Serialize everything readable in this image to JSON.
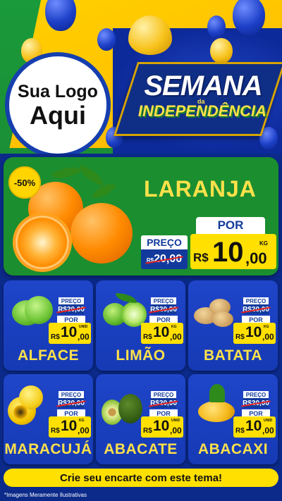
{
  "header": {
    "logo_line1": "Sua Logo",
    "logo_line2": "Aqui",
    "title_main": "SEMANA",
    "title_da": "da",
    "title_sub": "INDEPENDÊNCIA"
  },
  "featured": {
    "discount": "-50%",
    "name": "LARANJA",
    "preco_label": "PREÇO",
    "old_price_currency": "R$",
    "old_price": "20,00",
    "por_label": "POR",
    "currency": "R$",
    "price_int": "10",
    "price_dec": ",00",
    "unit": "KG"
  },
  "products": [
    {
      "name": "ALFACE",
      "preco_label": "PREÇO",
      "old_price": "R$20,00",
      "por_label": "POR",
      "currency": "R$",
      "price_int": "10",
      "price_dec": ",00",
      "unit": "UNID"
    },
    {
      "name": "LIMÃO",
      "preco_label": "PREÇO",
      "old_price": "R$20,00",
      "por_label": "POR",
      "currency": "R$",
      "price_int": "10",
      "price_dec": ",00",
      "unit": "KG"
    },
    {
      "name": "BATATA",
      "preco_label": "PREÇO",
      "old_price": "R$20,00",
      "por_label": "POR",
      "currency": "R$",
      "price_int": "10",
      "price_dec": ",00",
      "unit": "KG"
    },
    {
      "name": "MARACUJÁ",
      "preco_label": "PREÇO",
      "old_price": "R$20,00",
      "por_label": "POR",
      "currency": "R$",
      "price_int": "10",
      "price_dec": ",00",
      "unit": "KG"
    },
    {
      "name": "ABACATE",
      "preco_label": "PREÇO",
      "old_price": "R$20,00",
      "por_label": "POR",
      "currency": "R$",
      "price_int": "10",
      "price_dec": ",00",
      "unit": "UNID"
    },
    {
      "name": "ABACAXI",
      "preco_label": "PREÇO",
      "old_price": "R$20,00",
      "por_label": "POR",
      "currency": "R$",
      "price_int": "10",
      "price_dec": ",00",
      "unit": "UNID"
    }
  ],
  "cta_label": "Crie seu encarte com este tema!",
  "disclaimer": "*Imagens Meramente Ilustrativas",
  "colors": {
    "brand_blue": "#163ab5",
    "brand_green": "#1b8e2f",
    "brand_yellow": "#ffe000",
    "title_yellow": "#ffe14a"
  }
}
